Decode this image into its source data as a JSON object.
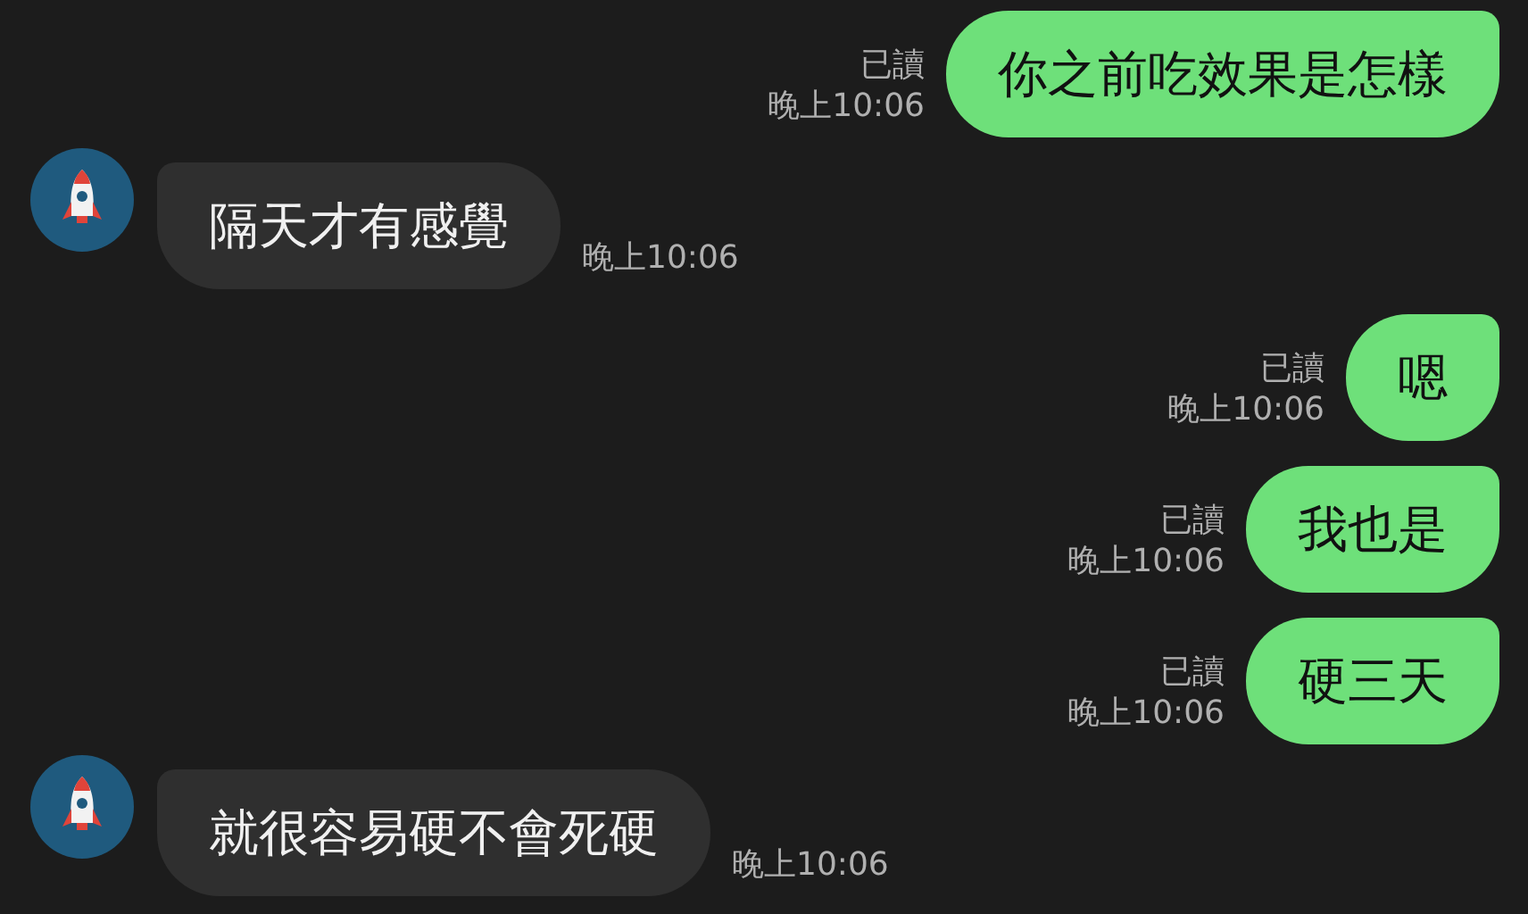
{
  "messages": [
    {
      "kind": "outgoing",
      "text": "你之前吃效果是怎樣",
      "read": "已讀",
      "time": "晚上10:06"
    },
    {
      "kind": "incoming",
      "text": "隔天才有感覺",
      "time": "晚上10:06"
    },
    {
      "kind": "outgoing",
      "text": "嗯",
      "read": "已讀",
      "time": "晚上10:06"
    },
    {
      "kind": "outgoing",
      "text": "我也是",
      "read": "已讀",
      "time": "晚上10:06"
    },
    {
      "kind": "outgoing",
      "text": "硬三天",
      "read": "已讀",
      "time": "晚上10:06"
    },
    {
      "kind": "incoming",
      "text": "就很容易硬不會死硬",
      "time": "晚上10:06"
    }
  ]
}
